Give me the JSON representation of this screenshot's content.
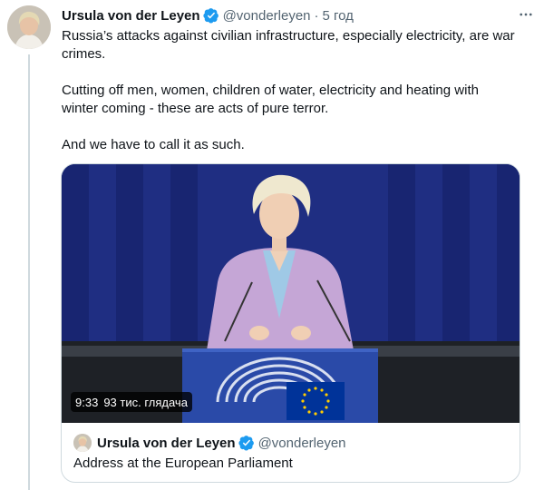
{
  "tweet": {
    "author_name": "Ursula von der Leyen",
    "handle": "@vonderleyen",
    "separator": "·",
    "time": "5 год",
    "paragraphs": [
      "Russia’s attacks against civilian infrastructure, especially electricity, are war crimes.",
      "Cutting off men, women, children of water, electricity and heating with winter coming - these are acts of pure terror.",
      "And we have to call it as such."
    ]
  },
  "media": {
    "duration": "9:33",
    "views": "93 тис. глядача"
  },
  "quoted": {
    "author_name": "Ursula von der Leyen",
    "handle": "@vonderleyen",
    "text": "Address at the European Parliament"
  },
  "colors": {
    "verified_badge": "#1d9bf0",
    "text_primary": "#0f1419",
    "text_secondary": "#536471",
    "border": "#cfd9de",
    "eu_flag": "#003399",
    "eu_star": "#ffcc00"
  },
  "icons": [
    "verified-icon",
    "more-icon"
  ]
}
